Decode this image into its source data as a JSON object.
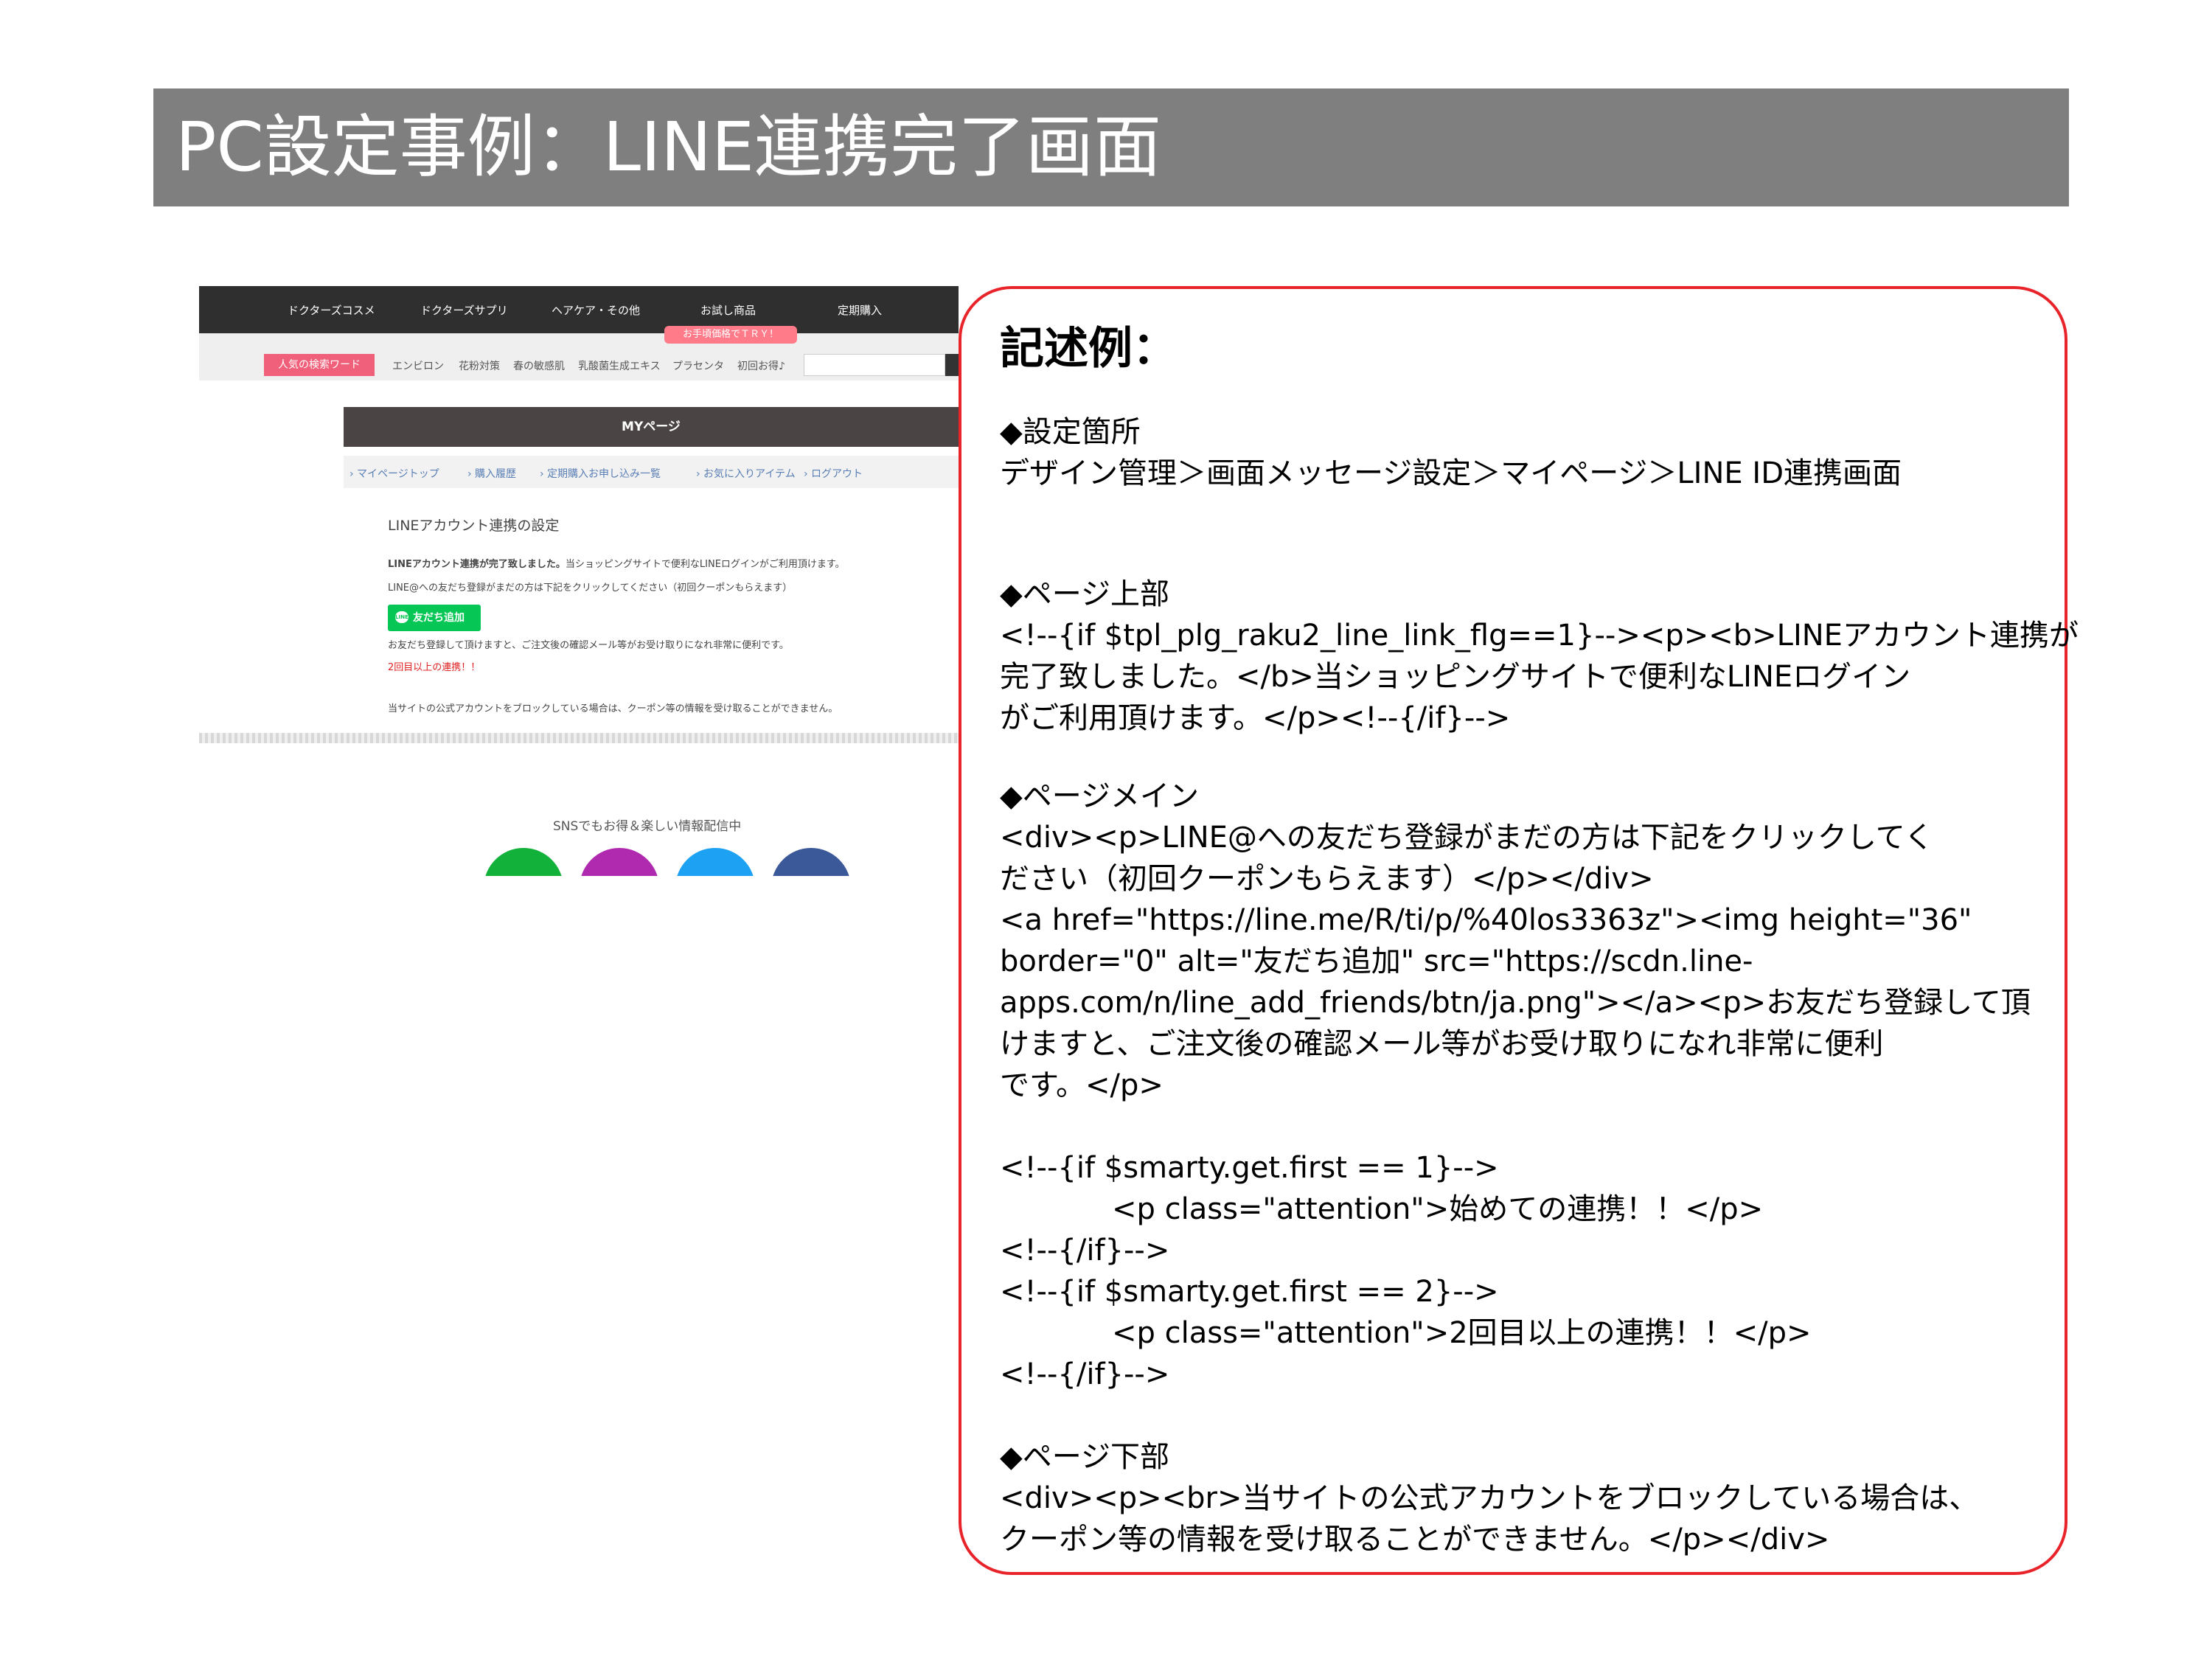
{
  "slide_title": "PC設定事例：LINE連携完了画面",
  "screenshot": {
    "nav_items": [
      "ドクターズコスメ",
      "ドクターズサプリ",
      "ヘアケア・その他",
      "お試し商品",
      "定期購入"
    ],
    "promo_badge": "お手頃価格でＴＲＹ！",
    "keyword_label": "人気の検索ワード",
    "keywords": [
      "エンビロン",
      "花粉対策",
      "春の敏感肌",
      "乳酸菌生成エキス",
      "プラセンタ",
      "初回お得♪"
    ],
    "mypage_title": "MYページ",
    "subnav": [
      "› マイページトップ",
      "› 購入履歴",
      "› 定期購入お申し込み一覧",
      "› お気に入りアイテム",
      "› ログアウト"
    ],
    "section_heading": "LINEアカウント連携の設定",
    "complete_bold": "LINEアカウント連携が完了致しました。",
    "complete_rest": "当ショッピングサイトで便利なLINEログインがご利用頂けます。",
    "friend_prompt": "LINE@への友だち登録がまだの方は下記をクリックしてください（初回クーポンもらえます）",
    "line_logo": "LINE",
    "add_friend_button": "友だち追加",
    "benefit_text": "お友だち登録して頂けますと、ご注文後の確認メール等がお受け取りになれ非常に便利です。",
    "attention": "2回目以上の連携！！",
    "block_notice": "当サイトの公式アカウントをブロックしている場合は、クーポン等の情報を受け取ることができません。",
    "sns_title": "SNSでもお得＆楽しい情報配信中"
  },
  "code_box": {
    "heading": "記述例：",
    "lines": [
      "◆設定箇所",
      "デザイン管理＞画面メッセージ設定＞マイページ＞LINE ID連携画面",
      "◆ページ上部",
      "<!--{if $tpl_plg_raku2_line_link_flg==1}--><p><b>LINEアカウント連携が",
      "完了致しました。</b>当ショッピングサイトで便利なLINEログイン",
      "がご利用頂けます。</p><!--{/if}-->",
      "◆ページメイン",
      "<div><p>LINE@への友だち登録がまだの方は下記をクリックしてく",
      "ださい（初回クーポンもらえます）</p></div>",
      "<a href=\"https://line.me/R/ti/p/%40los3363z\"><img height=\"36\"",
      "border=\"0\" alt=\"友だち追加\" src=\"https://scdn.line-",
      "apps.com/n/line_add_friends/btn/ja.png\"></a><p>お友だち登録して頂",
      "けますと、ご注文後の確認メール等がお受け取りになれ非常に便利",
      "です。</p>",
      "<!--{if $smarty.get.first == 1}-->",
      "<p class=\"attention\">始めての連携！！</p>",
      "<!--{/if}-->",
      "<!--{if $smarty.get.first == 2}-->",
      "<p class=\"attention\">2回目以上の連携！！</p>",
      "<!--{/if}-->",
      "◆ページ下部",
      "<div><p><br>当サイトの公式アカウントをブロックしている場合は、",
      "クーポン等の情報を受け取ることができません。</p></div>"
    ]
  }
}
